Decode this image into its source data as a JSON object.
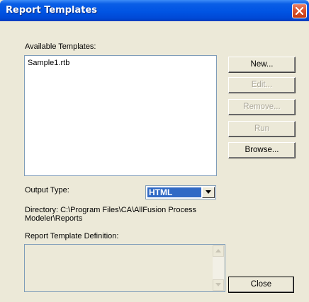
{
  "window": {
    "title": "Report Templates"
  },
  "labels": {
    "available_templates": "Available Templates:",
    "output_type": "Output Type:",
    "directory_line1": "Directory: C:\\Program Files\\CA\\AllFusion Process",
    "directory_line2": "Modeler\\Reports",
    "report_template_definition": "Report Template Definition:"
  },
  "templates": [
    "Sample1.rtb"
  ],
  "buttons": {
    "new": "New...",
    "edit": "Edit...",
    "remove": "Remove...",
    "run": "Run",
    "browse": "Browse...",
    "close": "Close"
  },
  "output_type": {
    "selected": "HTML"
  },
  "icons": {
    "close": "close-icon",
    "dropdown": "chevron-down-icon",
    "scroll_up": "scroll-up-icon",
    "scroll_down": "scroll-down-icon"
  },
  "colors": {
    "titlebar": "#0054e3",
    "selection": "#316ac5",
    "close_button": "#d8532f",
    "dialog_face": "#ece9d8",
    "disabled_text": "#aca899"
  }
}
